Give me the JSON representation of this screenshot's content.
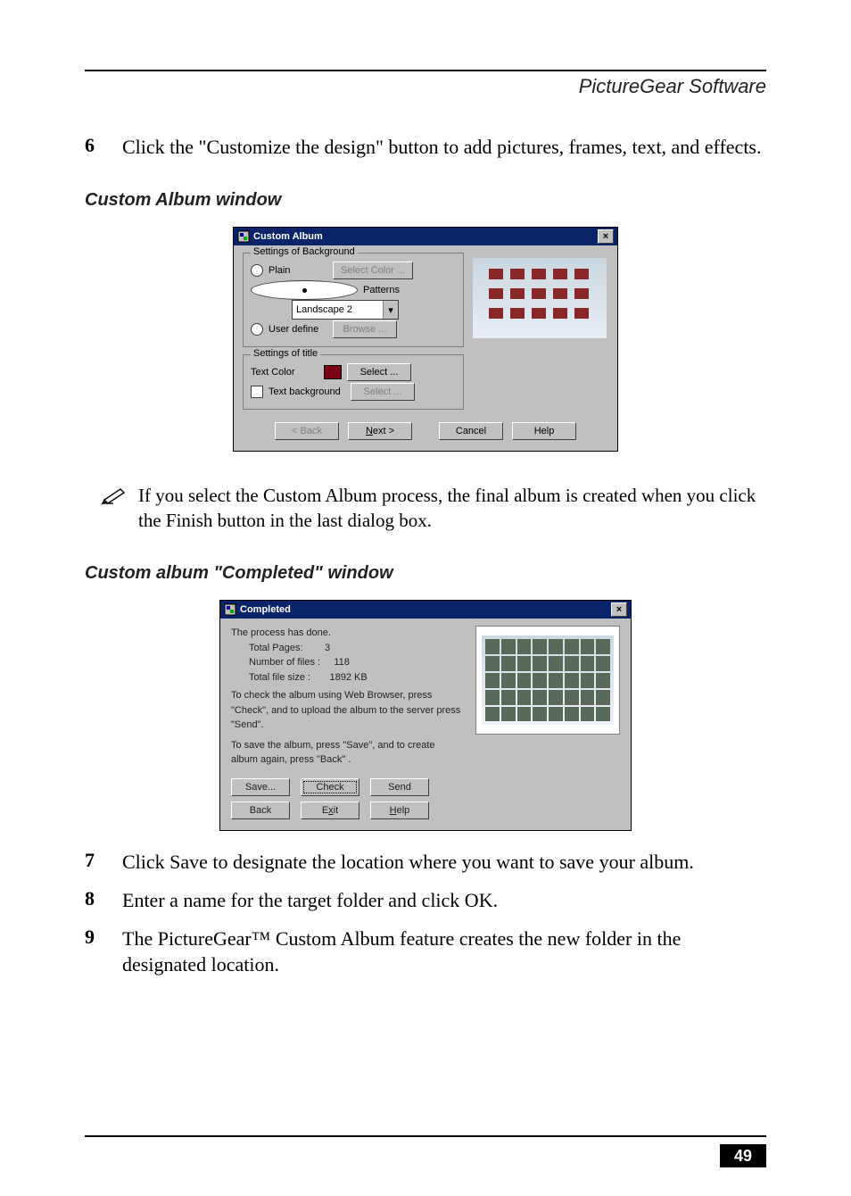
{
  "header": {
    "section_title": "PictureGear Software"
  },
  "step6": {
    "num": "6",
    "text": "Click the \"Customize the design\" button to add pictures, frames, text, and effects."
  },
  "custom_album_heading": "Custom Album window",
  "dlg1": {
    "title": "Custom Album",
    "grp_bg": "Settings of Background",
    "plain": "Plain",
    "select_color": "Select Color ...",
    "patterns": "Patterns",
    "pattern_value": "Landscape 2",
    "user_define": "User define",
    "browse": "Browse ...",
    "grp_title": "Settings of title",
    "text_color": "Text Color",
    "select": "Select ...",
    "text_bg": "Text background",
    "select2": "Select ...",
    "back": "< Back",
    "next": "Next >",
    "cancel": "Cancel",
    "help": "Help"
  },
  "note": "If you select the Custom Album process, the final album is created when you click the Finish button in the last dialog box.",
  "completed_heading": "Custom album \"Completed\" window",
  "dlg2": {
    "title": "Completed",
    "line_done": "The process has done.",
    "total_pages_label": "Total Pages:",
    "total_pages_value": "3",
    "num_files_label": "Number of files :",
    "num_files_value": "118",
    "total_size_label": "Total file size :",
    "total_size_value": "1892 KB",
    "p1": "To check the album using Web Browser, press \"Check\", and to upload the album to the server press \"Send\".",
    "p2": "To save the album, press \"Save\", and to create album again, press \"Back\" .",
    "save": "Save...",
    "check": "Check",
    "send": "Send",
    "back": "Back",
    "exit": "Exit",
    "help": "Help"
  },
  "step7": {
    "num": "7",
    "text": "Click Save to designate the location where you want to save your album."
  },
  "step8": {
    "num": "8",
    "text": "Enter a name for the target folder and click OK."
  },
  "step9": {
    "num": "9",
    "text": "The PictureGear™ Custom Album feature creates the new folder in the designated location."
  },
  "page_number": "49"
}
